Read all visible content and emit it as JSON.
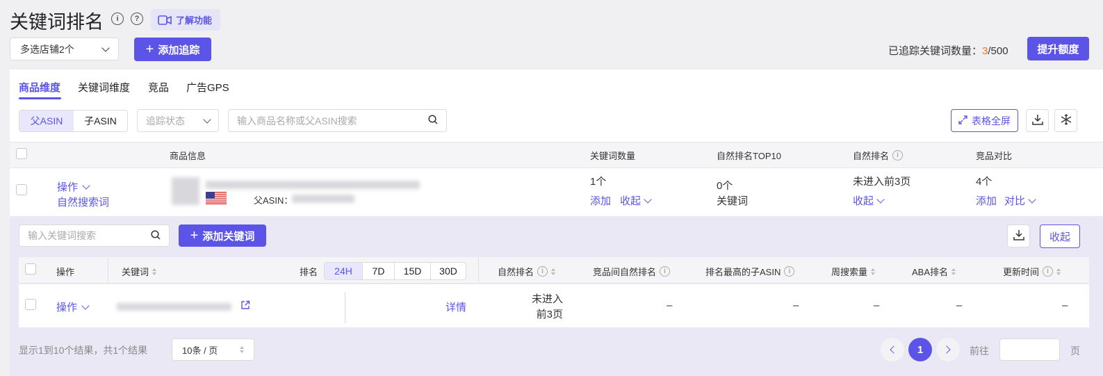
{
  "header": {
    "title": "关键词排名",
    "learn_label": "了解功能"
  },
  "toolbar": {
    "store_select": "多选店铺2个",
    "add_track_label": "添加追踪",
    "tracked_label": "已追踪关键词数量：",
    "tracked_count": "3",
    "tracked_total": "/500",
    "upgrade_label": "提升额度"
  },
  "tabs": [
    {
      "label": "商品维度",
      "active": true
    },
    {
      "label": "关键词维度"
    },
    {
      "label": "竞品"
    },
    {
      "label": "广告GPS"
    }
  ],
  "filters": {
    "seg_parent": "父ASIN",
    "seg_child": "子ASIN",
    "status_placeholder": "追踪状态",
    "search_placeholder": "输入商品名称或父ASIN搜索",
    "fullscreen_label": "表格全屏"
  },
  "main_table": {
    "headers": [
      "商品信息",
      "关键词数量",
      "自然排名TOP10",
      "自然排名",
      "竞品对比"
    ],
    "row": {
      "op_label": "操作",
      "natural_search": "自然搜索词",
      "asin_label": "父ASIN：",
      "kw_count": "1个",
      "add": "添加",
      "collapse": "收起",
      "top10_count": "0个",
      "top10_sub": "关键词",
      "rank": "未进入前3页",
      "competitor_count": "4个",
      "compare": "对比"
    }
  },
  "sub": {
    "search_placeholder": "输入关键词搜索",
    "add_kw_label": "添加关键词",
    "collapse_label": "收起",
    "headers": {
      "op": "操作",
      "keyword": "关键词",
      "rank": "排名",
      "natural_rank": "自然排名",
      "competitor_rank": "竞品间自然排名",
      "top_child": "排名最高的子ASIN",
      "weekly": "周搜索量",
      "aba": "ABA排名",
      "updated": "更新时间"
    },
    "periods": [
      "24H",
      "7D",
      "15D",
      "30D"
    ],
    "row": {
      "op_label": "操作",
      "detail": "详情",
      "natural_rank_1": "未进入",
      "natural_rank_2": "前3页",
      "competitor_rank": "–",
      "top_child": "–",
      "weekly": "–",
      "aba": "–",
      "updated": "–"
    }
  },
  "pagination": {
    "summary": "显示1到10个结果，共1个结果",
    "page_size": "10条 / 页",
    "current_page": "1",
    "goto_label": "前往",
    "page_unit": "页"
  },
  "colors": {
    "accent": "#5b54e6",
    "count_highlight": "#e8772e"
  }
}
